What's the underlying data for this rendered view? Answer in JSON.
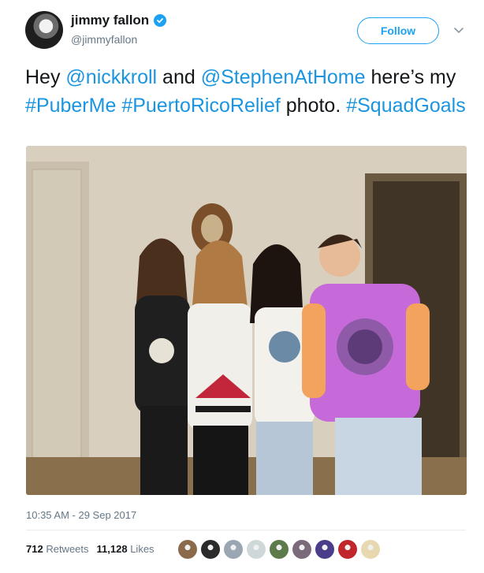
{
  "user": {
    "display_name": "jimmy fallon",
    "handle": "@jimmyfallon",
    "verified_icon": "verified-badge-icon"
  },
  "actions": {
    "follow_label": "Follow",
    "more_icon": "chevron-down-icon"
  },
  "tweet": {
    "segments": [
      {
        "text": "Hey ",
        "type": "text"
      },
      {
        "text": "@nickkroll",
        "type": "link"
      },
      {
        "text": " and ",
        "type": "text"
      },
      {
        "text": "@StephenAtHome",
        "type": "link"
      },
      {
        "text": " here’s my ",
        "type": "text"
      },
      {
        "text": "#PuberMe",
        "type": "link"
      },
      {
        "text": " ",
        "type": "text"
      },
      {
        "text": "#PuertoRicoRelief",
        "type": "link"
      },
      {
        "text": "  photo. ",
        "type": "text"
      },
      {
        "text": "#SquadGoals",
        "type": "link"
      }
    ],
    "timestamp": "10:35 AM - 29 Sep 2017"
  },
  "stats": {
    "retweets_count": "712",
    "retweets_label": "Retweets",
    "likes_count": "11,128",
    "likes_label": "Likes"
  },
  "colors": {
    "link": "#1b95e0",
    "accent": "#1da1f2",
    "muted": "#657786"
  },
  "liker_avatars": [
    "#8a6a4a",
    "#2b2b2b",
    "#9aa7b3",
    "#cfd8d8",
    "#5c7a4a",
    "#7a6a7a",
    "#4b3d8a",
    "#c0262c",
    "#e8d8b0"
  ]
}
